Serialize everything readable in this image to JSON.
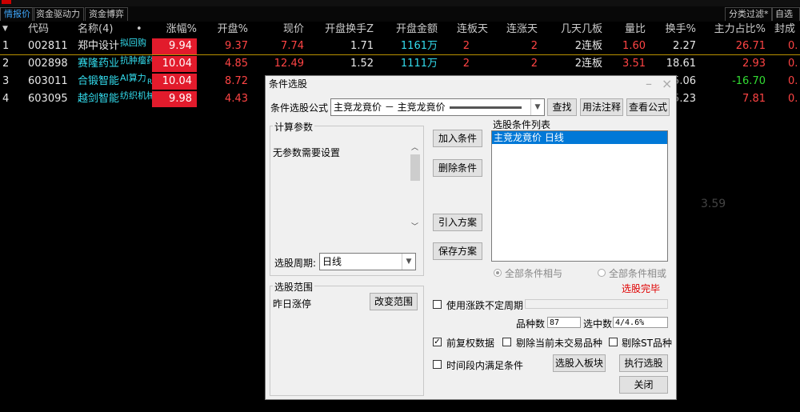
{
  "tabs": [
    "情报价",
    "资金驱动力",
    "资金博弈"
  ],
  "right_tabs": [
    "分类过滤*",
    "自选股"
  ],
  "columns": {
    "code": "代码",
    "name": "名称(4)",
    "dot": "•",
    "chg_pct": "涨幅%",
    "open_pct": "开盘%",
    "price": "现价",
    "open_turnover": "开盘换手Z",
    "open_amount": "开盘金额",
    "limit_days": "连板天",
    "up_days": "连涨天",
    "boards": "几天几板",
    "vol_ratio": "量比",
    "turnover": "换手%",
    "main_ratio": "主力占比%",
    "seal": "封成"
  },
  "rows": [
    {
      "idx": "1",
      "code": "002811",
      "name": "郑中设计",
      "tag": "拟回购",
      "chg": "9.94",
      "open": "9.37",
      "price": "7.74",
      "open_turn": "1.71",
      "open_amt": "1161万",
      "limit": "2",
      "up": "2",
      "boards": "2连板",
      "vr": "1.60",
      "turn": "2.27",
      "main": "26.71",
      "seal": "0."
    },
    {
      "idx": "2",
      "code": "002898",
      "name": "赛隆药业",
      "tag": "抗肿瘤药",
      "chg": "10.04",
      "open": "4.85",
      "price": "12.49",
      "open_turn": "1.52",
      "open_amt": "1111万",
      "limit": "2",
      "up": "2",
      "boards": "2连板",
      "vr": "3.51",
      "turn": "18.61",
      "main": "2.93",
      "seal": "0."
    },
    {
      "idx": "3",
      "code": "603011",
      "name": "合锻智能",
      "tag": "AI算力",
      "tag2": "R",
      "chg": "10.04",
      "open": "8.72",
      "price": "",
      "open_turn": "",
      "open_amt": "",
      "limit": "",
      "up": "",
      "boards": "",
      "vr": "",
      "turn": "5.06",
      "main": "-16.70",
      "seal": "0."
    },
    {
      "idx": "4",
      "code": "603095",
      "name": "越剑智能",
      "tag": "纺织机械",
      "chg": "9.98",
      "open": "4.43",
      "price": "",
      "open_turn": "",
      "open_amt": "",
      "limit": "",
      "up": "",
      "boards": "",
      "vr": "",
      "turn": "5.23",
      "main": "7.81",
      "seal": "0."
    }
  ],
  "ghost_text": "3.59",
  "dialog": {
    "title": "条件选股",
    "formula_label": "条件选股公式",
    "formula_value": "主竞龙竟价  －  主竞龙竟价",
    "btn_find": "查找",
    "btn_usage": "用法注释",
    "btn_view": "查看公式",
    "params_group": "计算参数",
    "params_text": "无参数需要设置",
    "period_label": "选股周期:",
    "period_value": "日线",
    "btn_add": "加入条件",
    "btn_delete": "删除条件",
    "btn_import": "引入方案",
    "btn_save": "保存方案",
    "list_label": "选股条件列表",
    "list_items": [
      "主竞龙竟价   日线"
    ],
    "radio_and": "全部条件相与",
    "radio_or": "全部条件相或",
    "status": "选股完毕",
    "range_group": "选股范围",
    "range_text": "昨日涨停",
    "btn_range": "改变范围",
    "use_period": "使用涨跌不定周期",
    "count_label": "品种数",
    "count_value": "87",
    "selected_label": "选中数",
    "selected_value": "4/4.6%",
    "chk_adjust": "前复权数据",
    "chk_exclude_untraded": "剔除当前未交易品种",
    "chk_exclude_st": "剔除ST品种",
    "chk_time_segment": "时间段内满足条件",
    "btn_to_block": "选股入板块",
    "btn_execute": "执行选股",
    "btn_close": "关闭"
  }
}
